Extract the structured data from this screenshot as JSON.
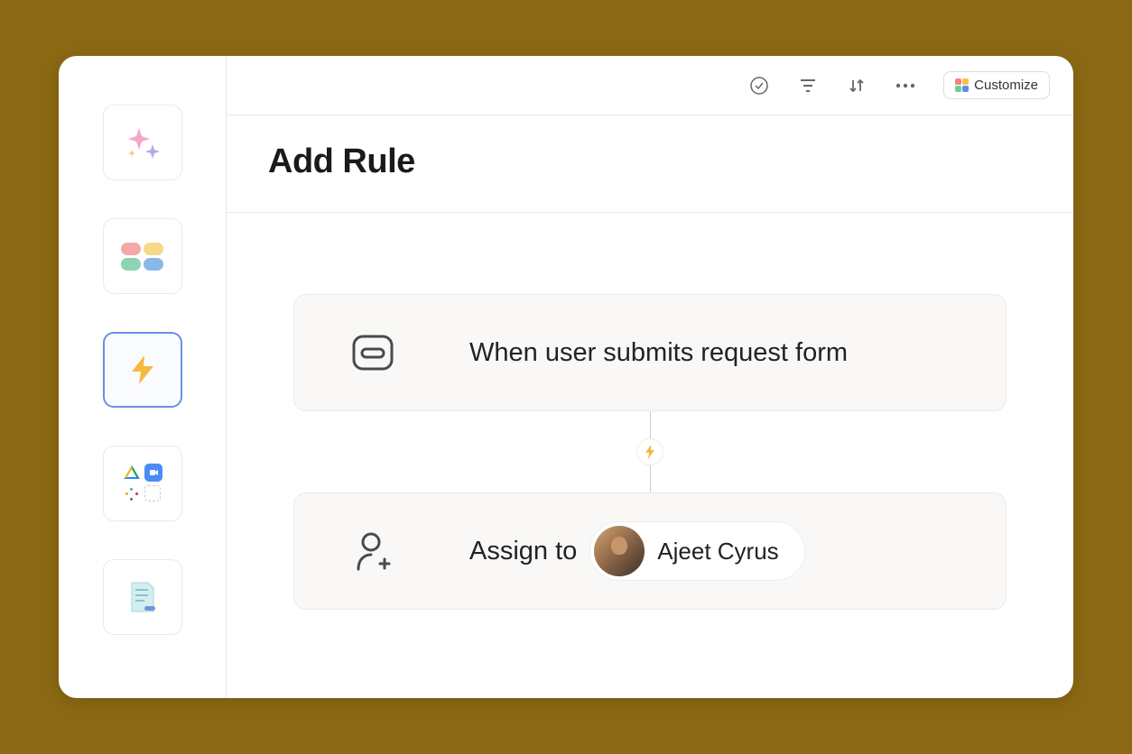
{
  "toolbar": {
    "customize_label": "Customize"
  },
  "header": {
    "title": "Add Rule"
  },
  "rule": {
    "trigger": {
      "text": "When user submits request form"
    },
    "action": {
      "label": "Assign to",
      "assignee_name": "Ajeet Cyrus"
    }
  },
  "colors": {
    "accent_yellow": "#f5b942",
    "active_border": "#6b8ee8"
  }
}
